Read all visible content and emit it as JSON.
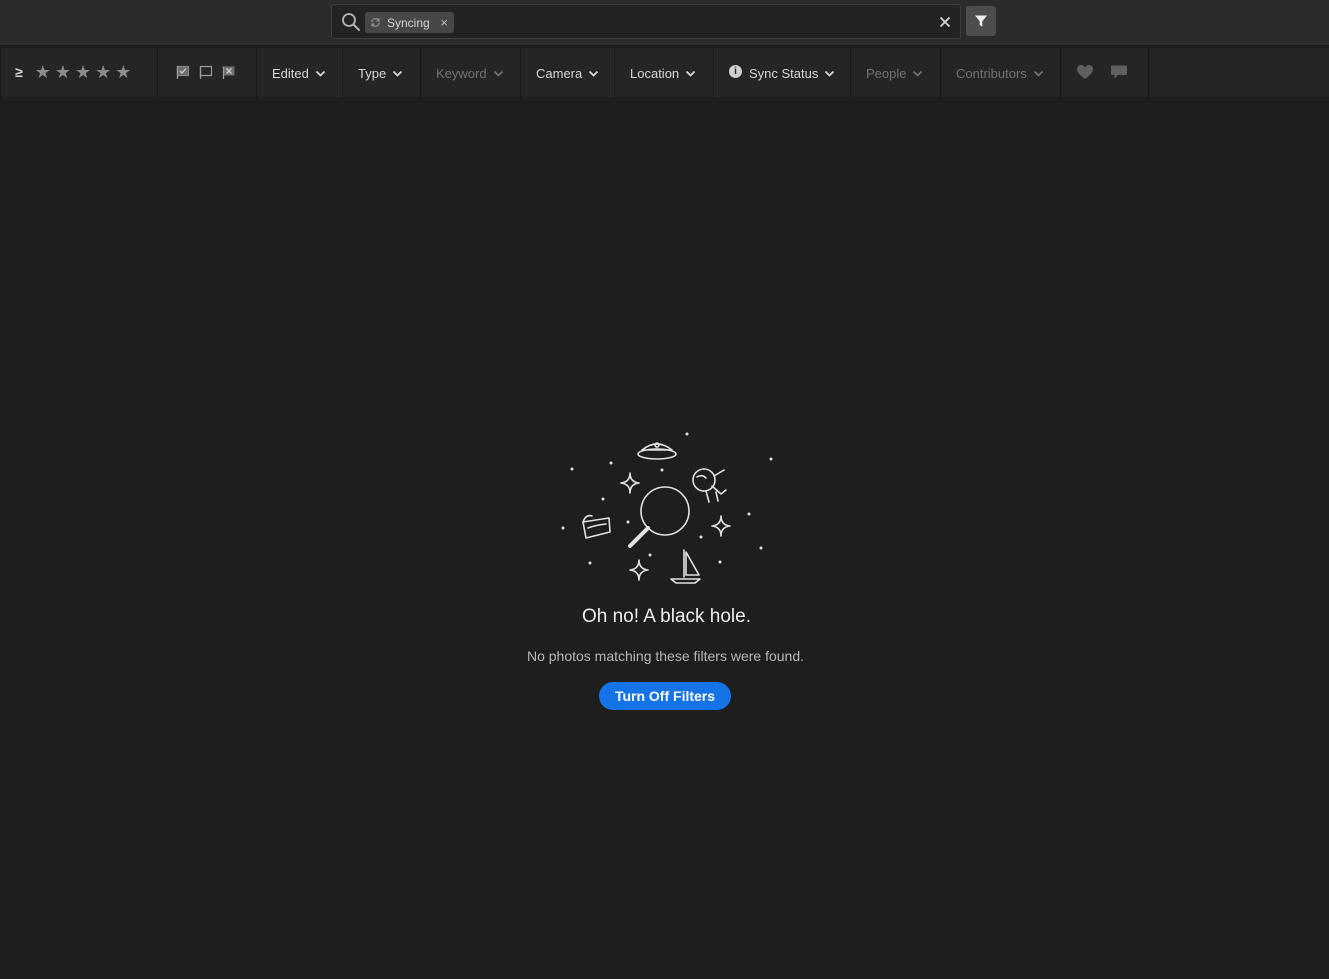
{
  "search": {
    "chip_label": "Syncing",
    "chip_remove": "×",
    "value": "",
    "placeholder": ""
  },
  "filterbar": {
    "rating_operator": "≥",
    "stars": [
      "★",
      "★",
      "★",
      "★",
      "★"
    ],
    "dropdowns": {
      "edited": "Edited",
      "type": "Type",
      "keyword": "Keyword",
      "camera": "Camera",
      "location": "Location",
      "sync_status": "Sync Status",
      "people": "People",
      "contributors": "Contributors"
    },
    "sync_status_info_glyph": "i"
  },
  "empty_state": {
    "title": "Oh no! A black hole.",
    "subtitle": "No photos matching these filters were found.",
    "button_label": "Turn Off Filters"
  },
  "colors": {
    "background": "#1e1e1e",
    "accent": "#1473e6"
  },
  "icons": [
    "search-icon",
    "sync-icon",
    "clear-icon",
    "filter-funnel-icon",
    "star-icon",
    "flag-pick-icon",
    "flag-unflagged-icon",
    "flag-reject-icon",
    "chevron-down-icon",
    "info-icon",
    "heart-icon",
    "comment-icon"
  ]
}
